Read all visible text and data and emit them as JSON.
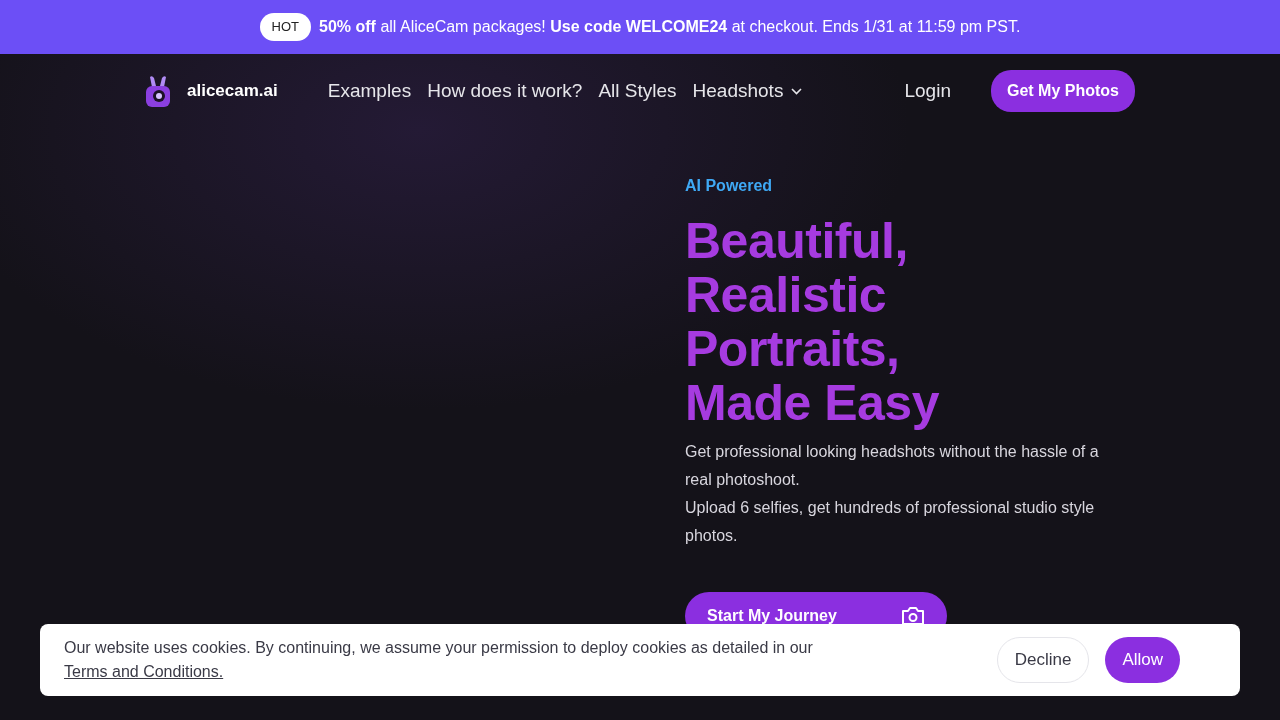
{
  "promo_banner": {
    "badge": "HOT",
    "text": "**50% off** all AliceCam packages! **Use code WELCOME24** at checkout. Ends 1/31 at 11:59 pm PST."
  },
  "navbar": {
    "brand": "alicecam.ai",
    "links": [
      {
        "label": "Examples",
        "dropdown": false
      },
      {
        "label": "How does it work?",
        "dropdown": false
      },
      {
        "label": "All Styles",
        "dropdown": false
      },
      {
        "label": "Headshots",
        "dropdown": true
      }
    ],
    "login": "Login",
    "cta": "Get My Photos"
  },
  "hero": {
    "eyebrow": "AI Powered",
    "headline": [
      "Beautiful,",
      "Realistic",
      "Portraits,",
      "Made Easy"
    ],
    "paragraphs": [
      "Get professional looking headshots without the hassle of a real photoshoot.",
      "Upload 6 selfies, get hundreds of professional studio style photos."
    ],
    "button": "Start My Journey"
  },
  "cookie_banner": {
    "text": "Our website uses cookies. By continuing, we assume your permission to deploy cookies as detailed in our",
    "link": "Terms and Conditions.",
    "buttons": [
      {
        "label": "Decline",
        "kind": "secondary"
      },
      {
        "label": "Allow",
        "kind": "primary"
      }
    ]
  }
}
